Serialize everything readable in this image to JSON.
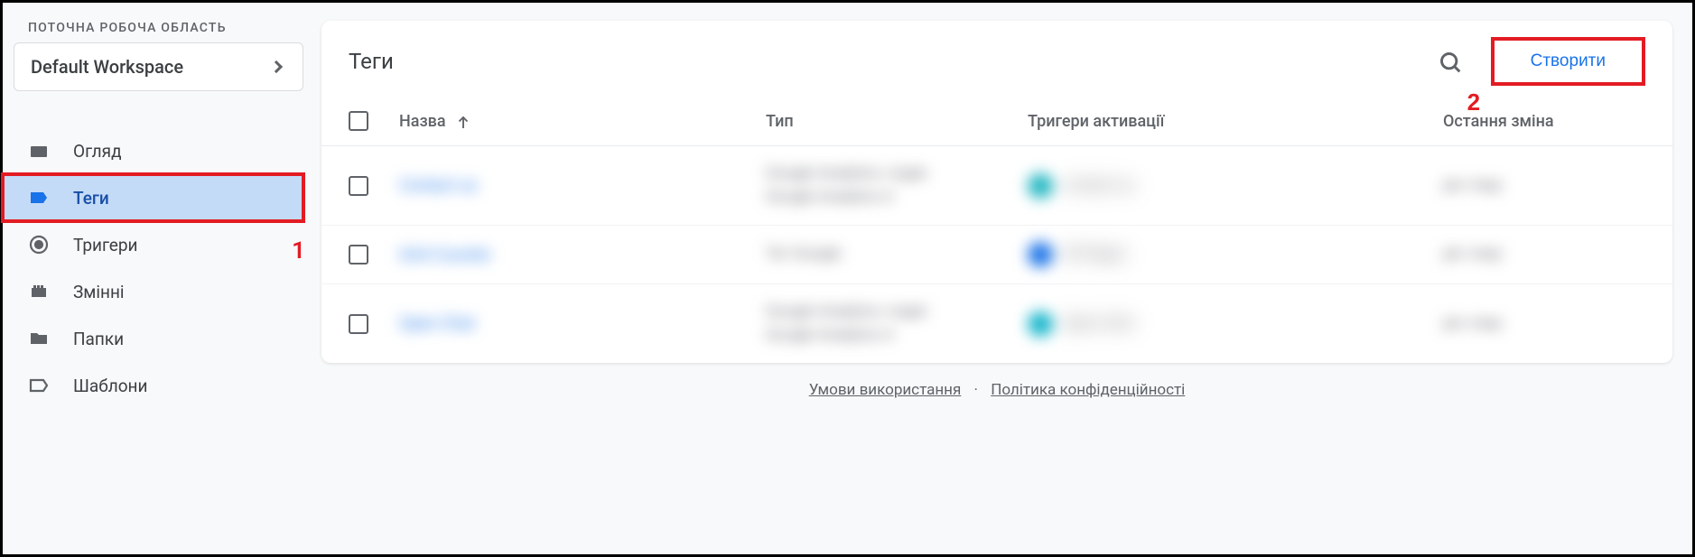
{
  "sidebar": {
    "workspace_label": "ПОТОЧНА РОБОЧА ОБЛАСТЬ",
    "workspace_name": "Default Workspace",
    "items": [
      {
        "label": "Огляд"
      },
      {
        "label": "Теги"
      },
      {
        "label": "Тригери"
      },
      {
        "label": "Змінні"
      },
      {
        "label": "Папки"
      },
      {
        "label": "Шаблони"
      }
    ]
  },
  "panel": {
    "title": "Теги",
    "create_label": "Створити",
    "columns": {
      "name": "Назва",
      "type": "Тип",
      "triggers": "Тригери активації",
      "modified": "Остання зміна"
    },
    "rows": [
      {
        "name": "Contact us",
        "type_line1": "Google Analytics: подія",
        "type_line2": "Google Analytics 4",
        "trigger": "contact us",
        "trigger_color": "#1fb6c1",
        "modified": "рік тому"
      },
      {
        "name": "GA4 Counter",
        "type_line1": "Тег Google",
        "type_line2": "",
        "trigger": "All Pages",
        "trigger_color": "#1a73e8",
        "modified": "рік тому"
      },
      {
        "name": "Open Chat",
        "type_line1": "Google Analytics: подія",
        "type_line2": "Google Analytics 4",
        "trigger": "Open Chat",
        "trigger_color": "#12b5cb",
        "modified": "рік тому"
      }
    ]
  },
  "annotations": {
    "one": "1",
    "two": "2"
  },
  "footer": {
    "terms": "Умови використання",
    "privacy": "Політика конфіденційності"
  }
}
